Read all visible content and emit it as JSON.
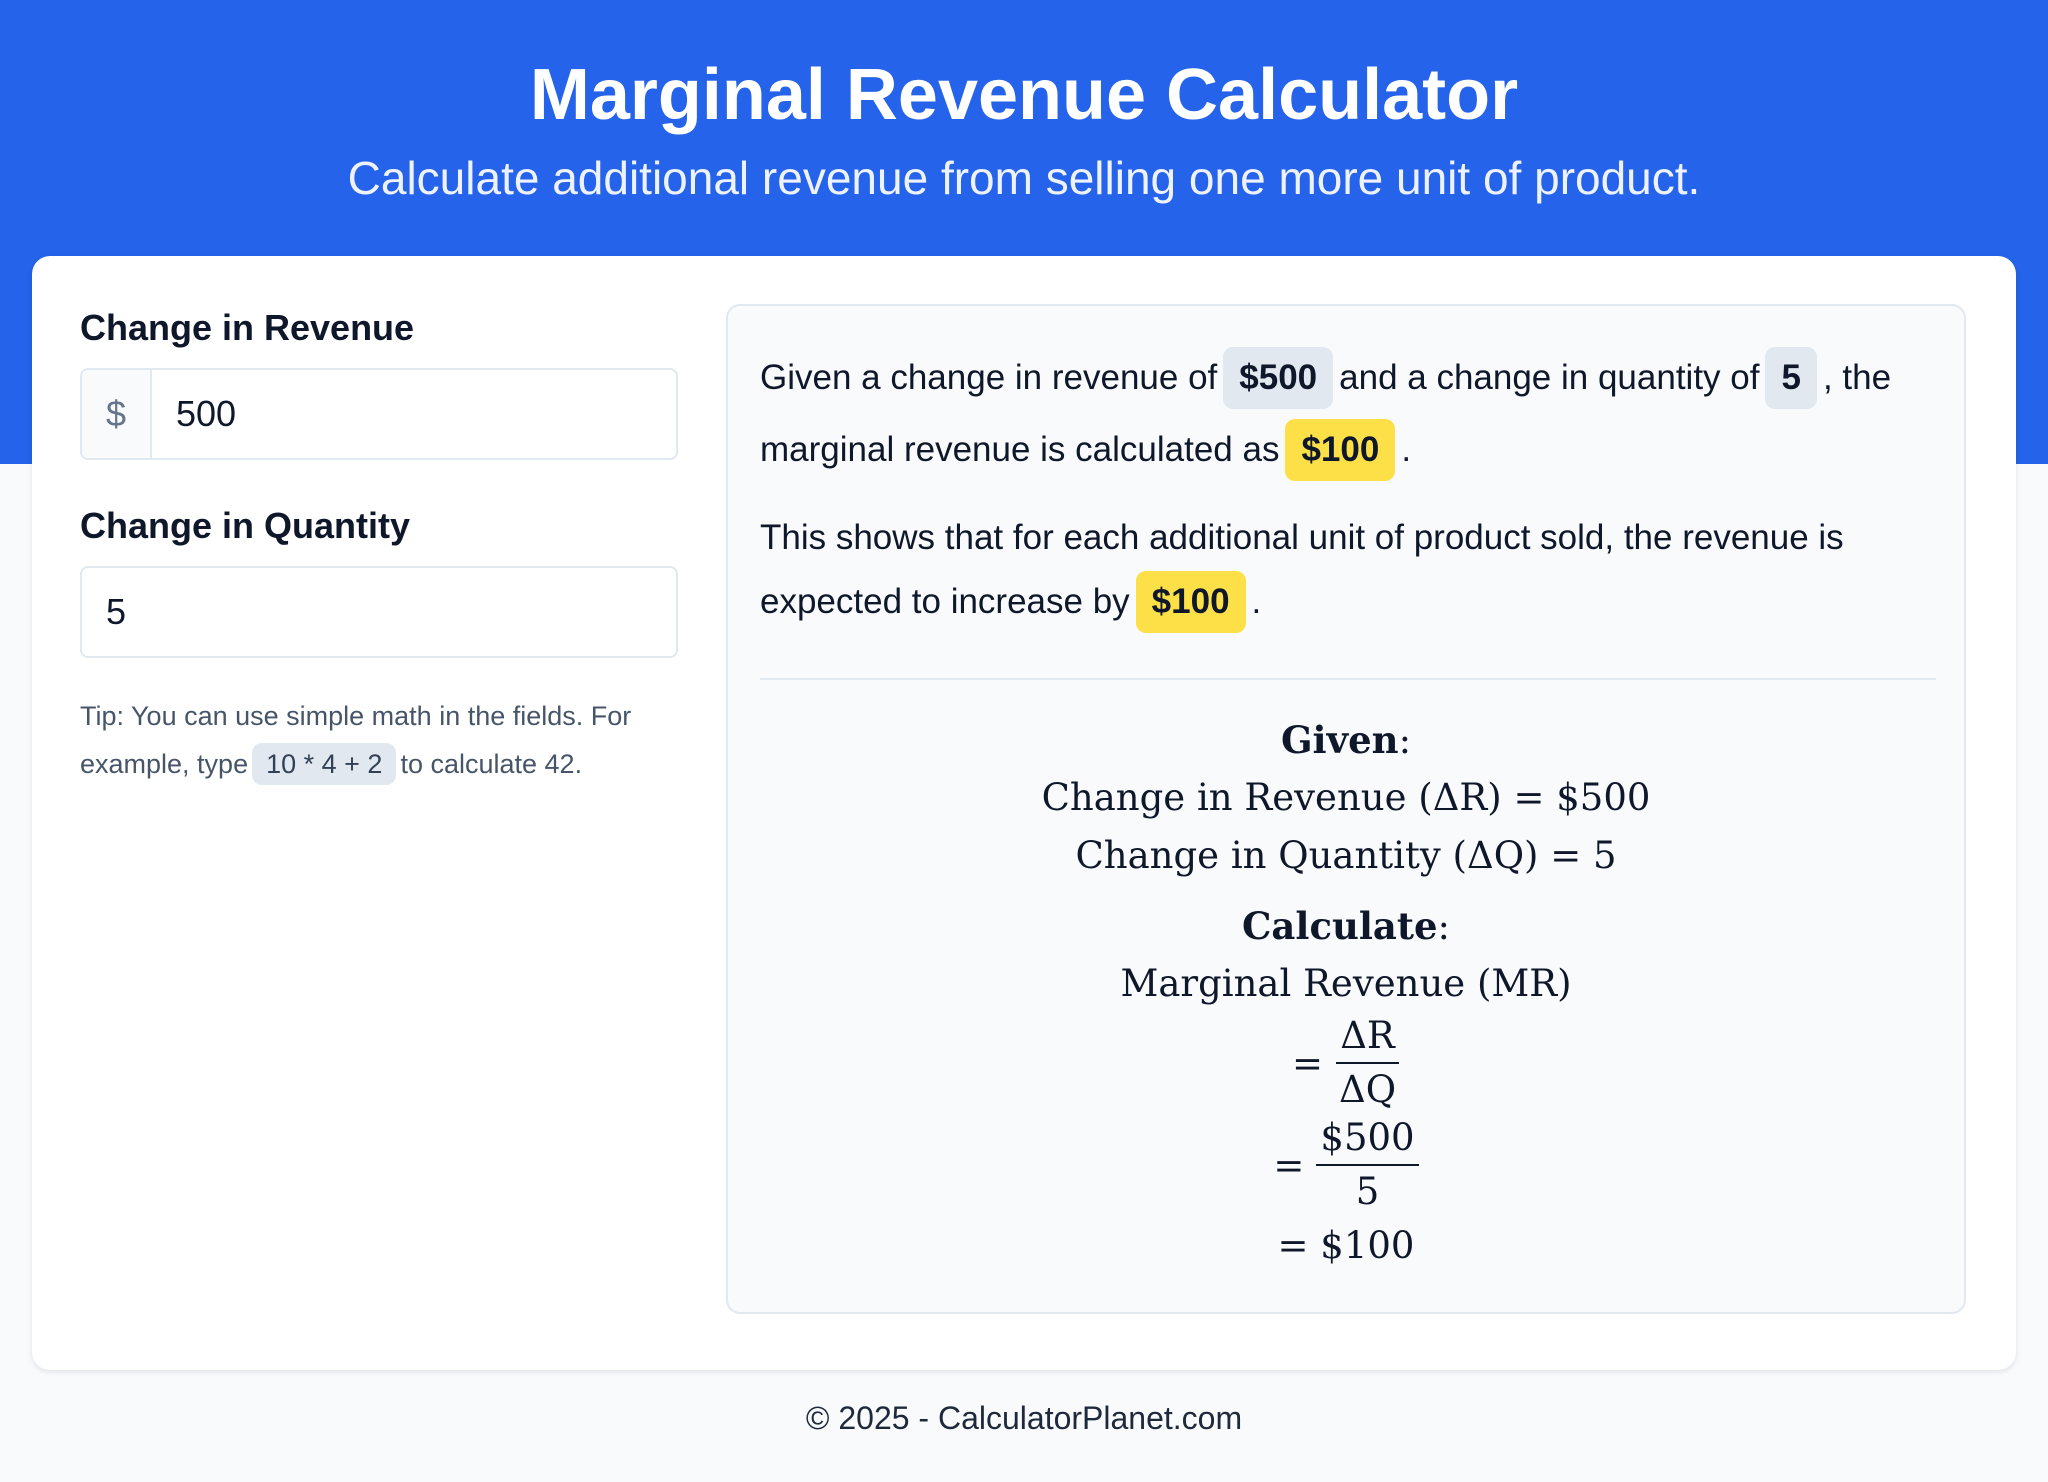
{
  "header": {
    "title": "Marginal Revenue Calculator",
    "subtitle": "Calculate additional revenue from selling one more unit of product."
  },
  "form": {
    "revenue_label": "Change in Revenue",
    "revenue_prefix": "$",
    "revenue_value": "500",
    "quantity_label": "Change in Quantity",
    "quantity_value": "5",
    "tip_before": "Tip: You can use simple math in the fields. For example, type",
    "tip_example": "10 * 4 + 2",
    "tip_after": "to calculate 42."
  },
  "result": {
    "p1_a": "Given a change in revenue of",
    "p1_revenue": "$500",
    "p1_b": "and a change in quantity of",
    "p1_quantity": "5",
    "p1_c": ", the marginal revenue is calculated as",
    "p1_mr": "$100",
    "p1_end": ".",
    "p2_a": "This shows that for each additional unit of product sold, the revenue is expected to increase by",
    "p2_mr": "$100",
    "p2_end": "."
  },
  "formula": {
    "given_label": "Given",
    "line_revenue": "Change in Revenue (ΔR) = $500",
    "line_quantity": "Change in Quantity (ΔQ) = 5",
    "calculate_label": "Calculate",
    "mr_label": "Marginal Revenue (MR)",
    "frac1_num": "ΔR",
    "frac1_den": "ΔQ",
    "frac2_num": "$500",
    "frac2_den": "5",
    "result_line": "= $100",
    "equals": "="
  },
  "footer": {
    "text": "© 2025 - CalculatorPlanet.com"
  },
  "colors": {
    "brand_blue": "#2563eb",
    "highlight_yellow": "#fde047",
    "chip_gray": "#e2e8f0"
  }
}
